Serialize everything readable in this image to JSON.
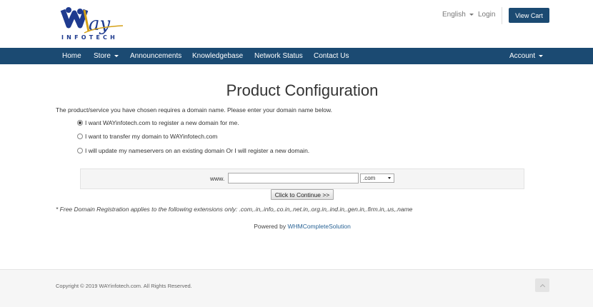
{
  "header": {
    "logo_sub": "INFOTECH",
    "language": "English",
    "login": "Login",
    "view_cart": "View Cart"
  },
  "nav": {
    "items": [
      "Home",
      "Store",
      "Announcements",
      "Knowledgebase",
      "Network Status",
      "Contact Us"
    ],
    "account": "Account"
  },
  "main": {
    "title": "Product Configuration",
    "intro": "The product/service you have chosen requires a domain name. Please enter your domain name below.",
    "options": [
      {
        "label": "I want WAYinfotech.com to register a new domain for me.",
        "selected": true
      },
      {
        "label": "I want to transfer my domain to WAYinfotech.com",
        "selected": false
      },
      {
        "label": "I will update my nameservers on an existing domain Or I will register a new domain.",
        "selected": false
      }
    ],
    "www_label": "www.",
    "domain_value": "",
    "tld_selected": ".com",
    "continue_label": "Click to Continue >>",
    "free_note": "* Free Domain Registration applies to the following extensions only: .com,.in,.info,.co.in,.net.in,.org.in,.ind.in,.gen.in,.firm.in,.us,.name",
    "powered_prefix": "Powered by",
    "powered_link": "WHMCompleteSolution"
  },
  "footer": {
    "copyright": "Copyright © 2019 WAYinfotech.com. All Rights Reserved."
  },
  "colors": {
    "brand": "#1b4a72",
    "logo_blue": "#1f3b8f",
    "logo_accent": "#d4a017"
  }
}
